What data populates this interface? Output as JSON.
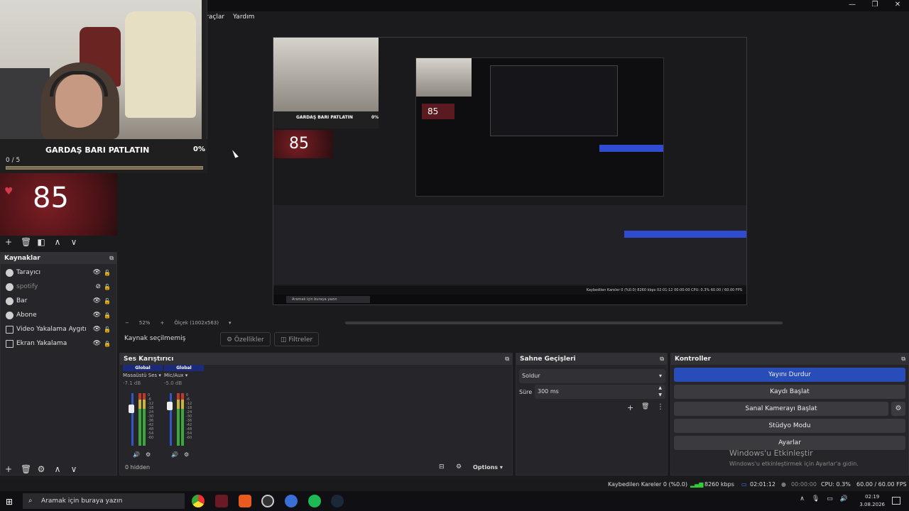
{
  "menu": {
    "tools": "Araçlar",
    "help": "Yardım"
  },
  "window": {
    "minimize": "—",
    "restore": "❐",
    "close": "✕"
  },
  "overlay": {
    "title": "GARDAŞ BARI PATLATIN",
    "percent": "0%",
    "count": "0 / 5",
    "progress": 0
  },
  "counter": {
    "heart": "♥",
    "value": "85"
  },
  "scene_toolbar": {
    "add": "+",
    "remove": "🗑",
    "filter": "◧",
    "up": "∧",
    "down": "∨"
  },
  "sources": {
    "title": "Kaynaklar",
    "items": [
      {
        "label": "Tarayıcı",
        "visible": true,
        "locked": false
      },
      {
        "label": "spotify",
        "visible": false,
        "locked": false
      },
      {
        "label": "Bar",
        "visible": true,
        "locked": false
      },
      {
        "label": "Abone",
        "visible": true,
        "locked": true
      },
      {
        "label": "Video Yakalama Aygıtı",
        "visible": true,
        "locked": false
      },
      {
        "label": "Ekran Yakalama",
        "visible": true,
        "locked": true
      }
    ]
  },
  "nested": {
    "title": "GARDAŞ BARI PATLATIN",
    "percent": "0%",
    "counter": "85",
    "inner_counter": "85",
    "status": "Kaybedilen Kareler 0 (%0.0)   8260 kbps   02:01:12   00:00:00   CPU: 0.3%   60.00 / 60.00 FPS",
    "search": "Aramak için buraya yazın"
  },
  "zoom": {
    "minus": "−",
    "level": "52%",
    "plus": "+",
    "canvas": "Ölçek (1002x563)"
  },
  "source_bar": {
    "label": "Kaynak seçilmemiş",
    "properties": "⚙ Özellikler",
    "filters": "◫ Filtreler"
  },
  "mixer": {
    "title": "Ses Karıştırıcı",
    "channels": [
      {
        "badge": "Global",
        "name": "Masaüstü Ses",
        "db": "-7.1 dB"
      },
      {
        "badge": "Global",
        "name": "Mic/Aux",
        "db": "-5.0 dB"
      }
    ],
    "scale": [
      "0",
      "-6",
      "-12",
      "-18",
      "-24",
      "-30",
      "-36",
      "-42",
      "-48",
      "-54",
      "-60"
    ],
    "hidden": "0 hidden",
    "options": "Options"
  },
  "transitions": {
    "title": "Sahne Geçişleri",
    "selected": "Soldur",
    "duration_label": "Süre",
    "duration": "300 ms"
  },
  "controls": {
    "title": "Kontroller",
    "stop_stream": "Yayını Durdur",
    "start_record": "Kaydı Başlat",
    "virtual_cam": "Sanal Kamerayı Başlat",
    "studio": "Stüdyo Modu",
    "settings": "Ayarlar"
  },
  "watermark": {
    "title": "Windows'u Etkinleştir",
    "sub": "Windows'u etkinleştirmek için Ayarlar'a gidin."
  },
  "status": {
    "dropped": "Kaybedilen Kareler 0 (%0.0)",
    "bitrate": "8260 kbps",
    "stream_time": "02:01:12",
    "record_time": "00:00:00",
    "cpu": "CPU: 0.3%",
    "fps": "60.00 / 60.00 FPS"
  },
  "taskbar": {
    "search": "Aramak için buraya yazın",
    "time": "02:19",
    "date": "3.08.2026"
  },
  "colors": {
    "accent": "#284cb8",
    "panel": "#26262a",
    "background": "#1b1b1e"
  }
}
